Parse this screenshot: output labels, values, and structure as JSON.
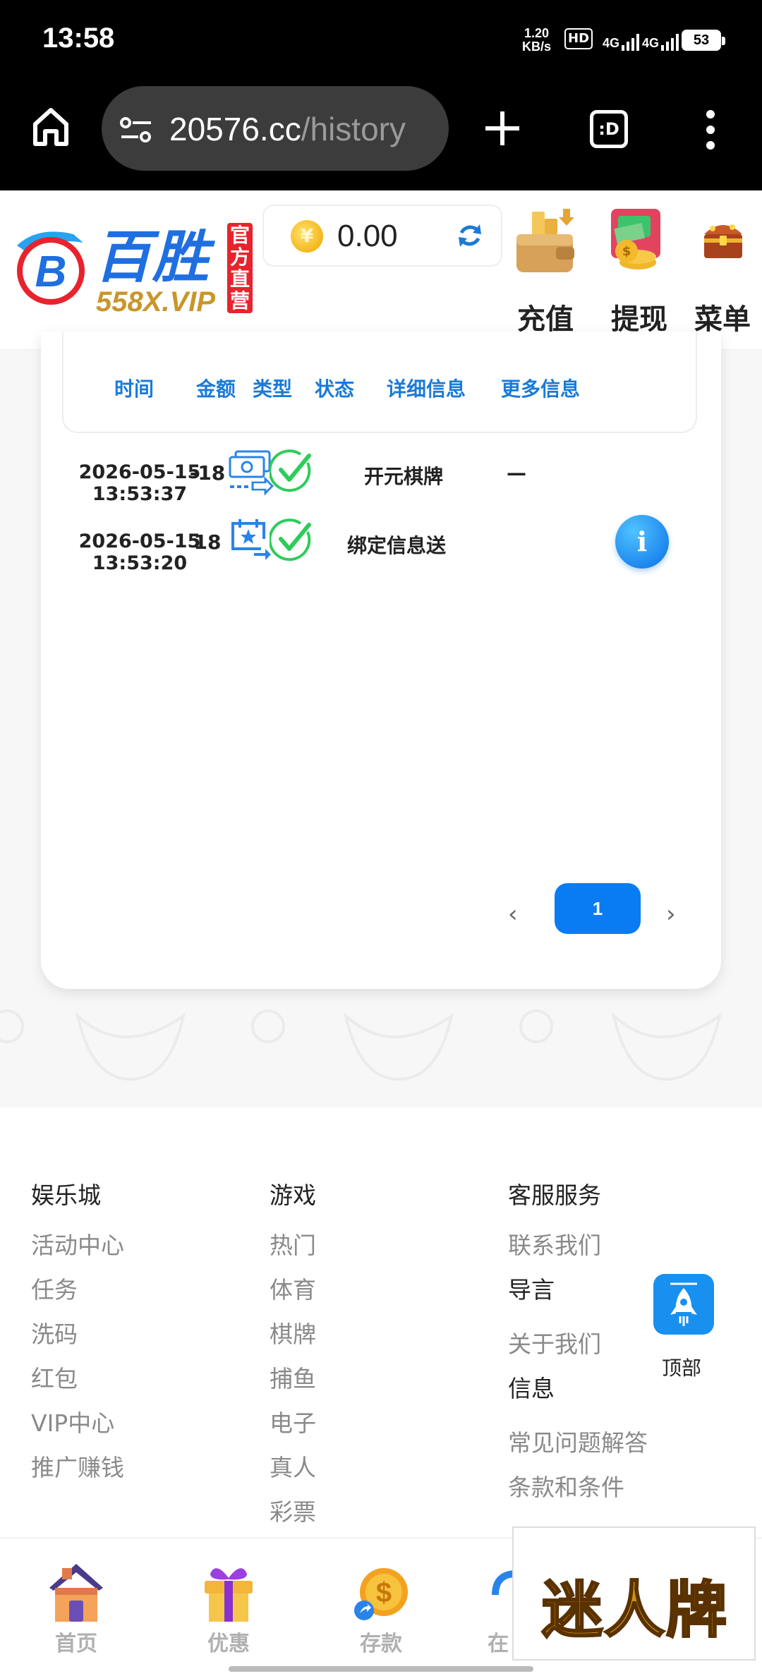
{
  "status_bar": {
    "time": "13:58",
    "net_speed_value": "1.20",
    "net_speed_unit": "KB/s",
    "hd": "HD",
    "signal1": "4G",
    "signal2": "4G",
    "battery": "53"
  },
  "browser": {
    "url_domain": "20576.cc",
    "url_path": "/history",
    "tab_switcher_label": ":D"
  },
  "header": {
    "logo_name": "百胜",
    "logo_domain": "558X.VIP",
    "logo_tag": "官方直营",
    "coin_symbol": "¥",
    "balance": "0.00",
    "actions": [
      "充值",
      "提现",
      "菜单"
    ]
  },
  "table": {
    "headers": [
      "时间",
      "金额",
      "类型",
      "状态",
      "详细信息",
      "更多信息"
    ],
    "rows": [
      {
        "time": "2026-05-15 13:53:37",
        "amount": "-18",
        "type_icon": "money-transfer-icon",
        "status_icon": "check-circle-icon",
        "detail": "开元棋牌",
        "more": "—"
      },
      {
        "time": "2026-05-15 13:53:20",
        "amount": "18",
        "type_icon": "calendar-star-icon",
        "status_icon": "check-circle-icon",
        "detail": "绑定信息送",
        "more": "i"
      }
    ]
  },
  "pagination": {
    "prev": "‹",
    "current": "1",
    "next": "›"
  },
  "footer": {
    "col1": {
      "title": "娱乐城",
      "items": [
        "活动中心",
        "任务",
        "洗码",
        "红包",
        "VIP中心",
        "推广赚钱"
      ]
    },
    "col2": {
      "title": "游戏",
      "items": [
        "热门",
        "体育",
        "棋牌",
        "捕鱼",
        "电子",
        "真人",
        "彩票"
      ]
    },
    "col3": {
      "title": "客服服务",
      "items": [
        "联系我们",
        "导言",
        "关于我们",
        "信息",
        "常见问题解答",
        "条款和条件"
      ]
    },
    "to_top": "顶部"
  },
  "bottom_nav": [
    "首页",
    "优惠",
    "存款",
    "在"
  ],
  "watermark": "迷人牌",
  "colors": {
    "accent": "#0a7cf3",
    "table_header": "#1a7ad8",
    "success": "#22c55e",
    "brand_red": "#e8232d"
  }
}
